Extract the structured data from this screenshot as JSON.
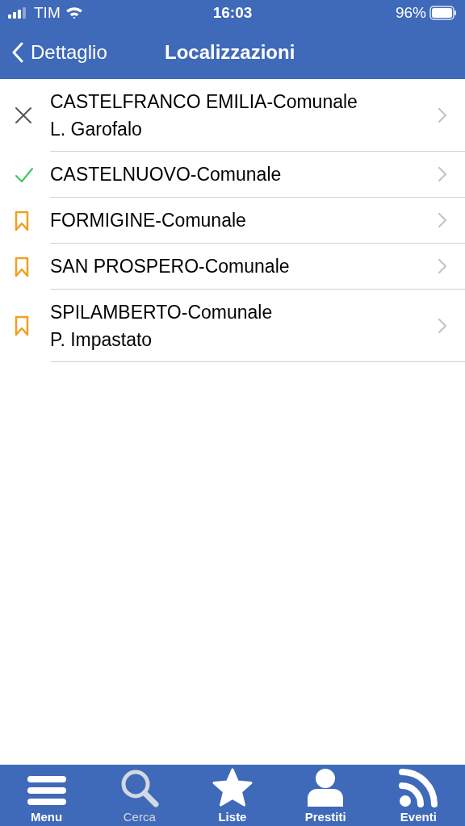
{
  "status_bar": {
    "carrier": "TIM",
    "time": "16:03",
    "battery": "96%"
  },
  "nav": {
    "back": "Dettaglio",
    "title": "Localizzazioni"
  },
  "locations": [
    {
      "kind": "unavailable",
      "name": "CASTELFRANCO EMILIA-Comunale",
      "subtitle": "L. Garofalo"
    },
    {
      "kind": "available",
      "name": "CASTELNUOVO-Comunale"
    },
    {
      "kind": "bookmark",
      "name": "FORMIGINE-Comunale"
    },
    {
      "kind": "bookmark",
      "name": "SAN PROSPERO-Comunale"
    },
    {
      "kind": "bookmark",
      "name": "SPILAMBERTO-Comunale",
      "subtitle": "P. Impastato"
    }
  ],
  "tabs": [
    {
      "kind": "menu",
      "label": "Menu",
      "selected": false
    },
    {
      "kind": "search",
      "label": "Cerca",
      "selected": true
    },
    {
      "kind": "star",
      "label": "Liste",
      "selected": false
    },
    {
      "kind": "person",
      "label": "Prestiti",
      "selected": false
    },
    {
      "kind": "feed",
      "label": "Eventi",
      "selected": false
    }
  ]
}
